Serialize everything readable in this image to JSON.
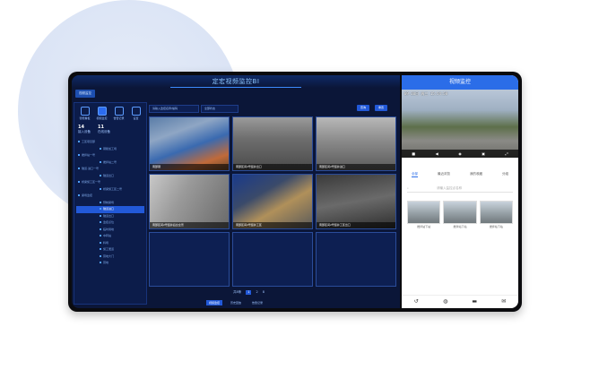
{
  "dashboard": {
    "title": "定宏视频监控BI",
    "tab": "视频监控",
    "side_icons": [
      "智能看板",
      "视频监控",
      "告警记录",
      "设置"
    ],
    "stats": [
      {
        "value": "14",
        "label": "接入设备"
      },
      {
        "value": "11",
        "label": "在线设备"
      }
    ],
    "tree": [
      {
        "label": "工区项目部",
        "level": 0
      },
      {
        "label": "钢筋加工场",
        "level": 1
      },
      {
        "label": "搅拌站一号",
        "level": 0
      },
      {
        "label": "搅拌站二号",
        "level": 1
      },
      {
        "label": "隧道·进口一号",
        "level": 0
      },
      {
        "label": "隧道出口",
        "level": 1
      },
      {
        "label": "桥梁施工区一号",
        "level": 0
      },
      {
        "label": "桥梁施工区二号",
        "level": 1
      },
      {
        "label": "梁场监控",
        "level": 0
      },
      {
        "label": "预制梁场",
        "level": 1
      },
      {
        "label": "隧道进口",
        "level": 1,
        "selected": true
      },
      {
        "label": "隧道出口",
        "level": 1
      },
      {
        "label": "监控点位",
        "level": 1
      },
      {
        "label": "临时用地",
        "level": 1
      },
      {
        "label": "中转站",
        "level": 1
      },
      {
        "label": "料场",
        "level": 1
      },
      {
        "label": "施工便道",
        "level": 1
      },
      {
        "label": "营地大门",
        "level": 1
      },
      {
        "label": "营地",
        "level": 1
      }
    ],
    "toolbar": {
      "select1": "请输入监控名称/编码",
      "select2": "全部状态",
      "btn1": "查询",
      "btn2": "重置"
    },
    "cameras": [
      {
        "caption": "南部钢"
      },
      {
        "caption": "南部区间2号竖井出口"
      },
      {
        "caption": "南部区间2号竖井进口"
      },
      {
        "caption": "南部区间2号竖井后台全景"
      },
      {
        "caption": "南部区间2号竖井工区"
      },
      {
        "caption": "南部区间2号竖井工区出口"
      }
    ],
    "pager": {
      "prev": "共8条",
      "current": "1",
      "next": "2",
      "size": "8"
    },
    "bottom_tabs": [
      "视频监控",
      "历史回放",
      "告警记录"
    ]
  },
  "mobile": {
    "title": "视频监控",
    "osd": "09-20日 周三 15:54:58",
    "tabs": [
      "全部",
      "最近浏览",
      "我的收藏",
      "分组"
    ],
    "search_placeholder": "请输入监控点名称",
    "thumbs": [
      "搅拌站下站",
      "搅拌站下站",
      "搅拌站下站"
    ]
  },
  "colors": {
    "accent": "#2b6de8",
    "dark_bg": "#0b1638"
  }
}
